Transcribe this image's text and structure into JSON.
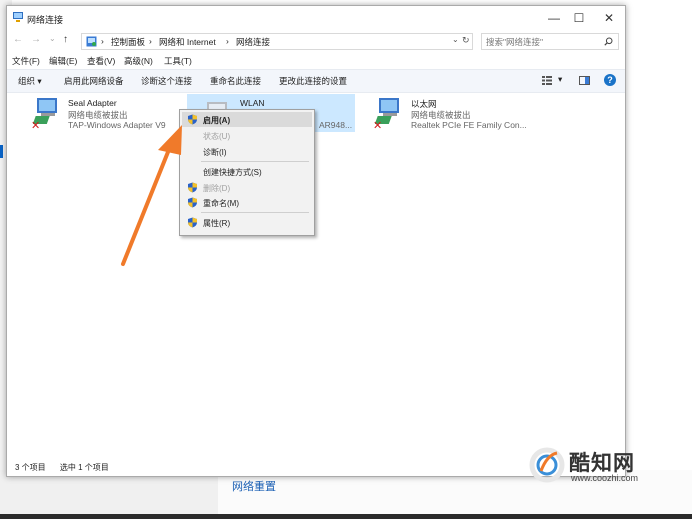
{
  "window": {
    "title": "网络连接"
  },
  "window_controls": {
    "minimize": "—",
    "maximize": "☐",
    "close": "✕"
  },
  "nav": {
    "back": "←",
    "forward": "→",
    "recent": "⌄",
    "up": "↑"
  },
  "breadcrumb": [
    "控制面板",
    "网络和 Internet",
    "网络连接"
  ],
  "breadcrumb_sep": "›",
  "address_dropdown": "⌄",
  "refresh": "↻",
  "search": {
    "placeholder": "搜索\"网络连接\"",
    "value": ""
  },
  "menu": [
    "文件(F)",
    "编辑(E)",
    "查看(V)",
    "高级(N)",
    "工具(T)"
  ],
  "commands": [
    "组织 ▾",
    "启用此网络设备",
    "诊断这个连接",
    "重命名此连接",
    "更改此连接的设置"
  ],
  "view_controls": {
    "change_view": "▾",
    "help": "?"
  },
  "connections": [
    {
      "name": "Seal Adapter",
      "status": "网络电缆被拔出",
      "device": "TAP-Windows Adapter V9",
      "selected": false
    },
    {
      "name": "WLAN",
      "status": "",
      "device": "AR948...",
      "selected": true
    },
    {
      "name": "以太网",
      "status": "网络电缆被拔出",
      "device": "Realtek PCIe FE Family Con...",
      "selected": false
    }
  ],
  "context_menu": [
    {
      "label": "启用(A)",
      "shield": true,
      "bold": true,
      "highlighted": true,
      "disabled": false
    },
    {
      "label": "状态(U)",
      "shield": false,
      "disabled": true
    },
    {
      "label": "诊断(I)",
      "shield": false,
      "disabled": false
    },
    {
      "label": "创建快捷方式(S)",
      "shield": false,
      "disabled": false
    },
    {
      "label": "删除(D)",
      "shield": true,
      "disabled": true
    },
    {
      "label": "重命名(M)",
      "shield": true,
      "disabled": false
    },
    {
      "label": "属性(R)",
      "shield": true,
      "disabled": false
    }
  ],
  "status_bar": {
    "count": "3 个项目",
    "selected": "选中 1 个项目"
  },
  "background": {
    "link": "网络重置"
  },
  "watermark": {
    "brand": "酷知网",
    "url": "www.coozhi.com"
  },
  "colors": {
    "selection": "#cce8ff",
    "accent": "#1a73c8",
    "arrow": "#f07a2a",
    "link": "#1a5fb4"
  }
}
